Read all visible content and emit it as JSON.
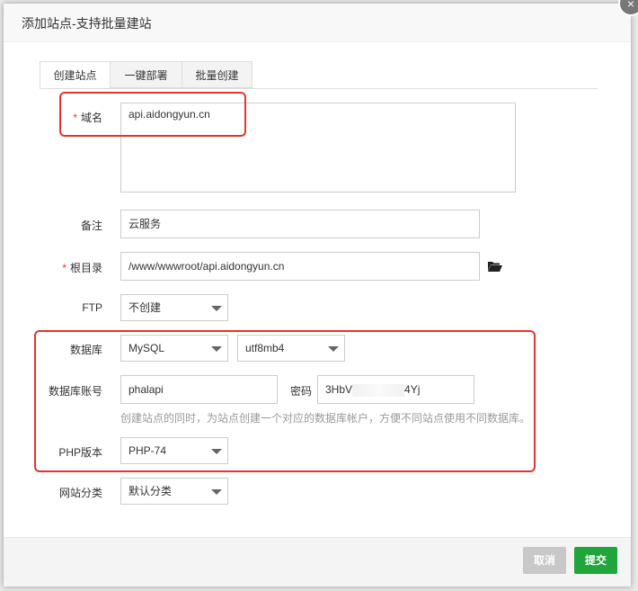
{
  "dialog": {
    "title": "添加站点-支持批量建站",
    "close_glyph": "×"
  },
  "tabs": [
    {
      "label": "创建站点"
    },
    {
      "label": "一键部署"
    },
    {
      "label": "批量创建"
    }
  ],
  "form": {
    "required_mark": "*",
    "domain": {
      "label": "域名",
      "value": "api.aidongyun.cn"
    },
    "remark": {
      "label": "备注",
      "value": "云服务"
    },
    "root": {
      "label": "根目录",
      "value": "/www/wwwroot/api.aidongyun.cn"
    },
    "ftp": {
      "label": "FTP",
      "value": "不创建"
    },
    "database": {
      "label": "数据库",
      "type": "MySQL",
      "charset": "utf8mb4"
    },
    "db_account": {
      "label": "数据库账号",
      "username": "phalapi",
      "password_label": "密码",
      "password_prefix": "3HbV",
      "password_suffix": "4Yj"
    },
    "hint": "创建站点的同时，为站点创建一个对应的数据库帐户，方便不同站点使用不同数据库。",
    "php": {
      "label": "PHP版本",
      "value": "PHP-74"
    },
    "category": {
      "label": "网站分类",
      "value": "默认分类"
    }
  },
  "footer": {
    "cancel_label": "取消",
    "submit_label": "提交"
  },
  "colors": {
    "accent_green": "#20a53a",
    "highlight_red": "#e5352c",
    "required_red": "#e33"
  },
  "icons": {
    "folder": "folder-open-icon",
    "close": "close-icon"
  }
}
